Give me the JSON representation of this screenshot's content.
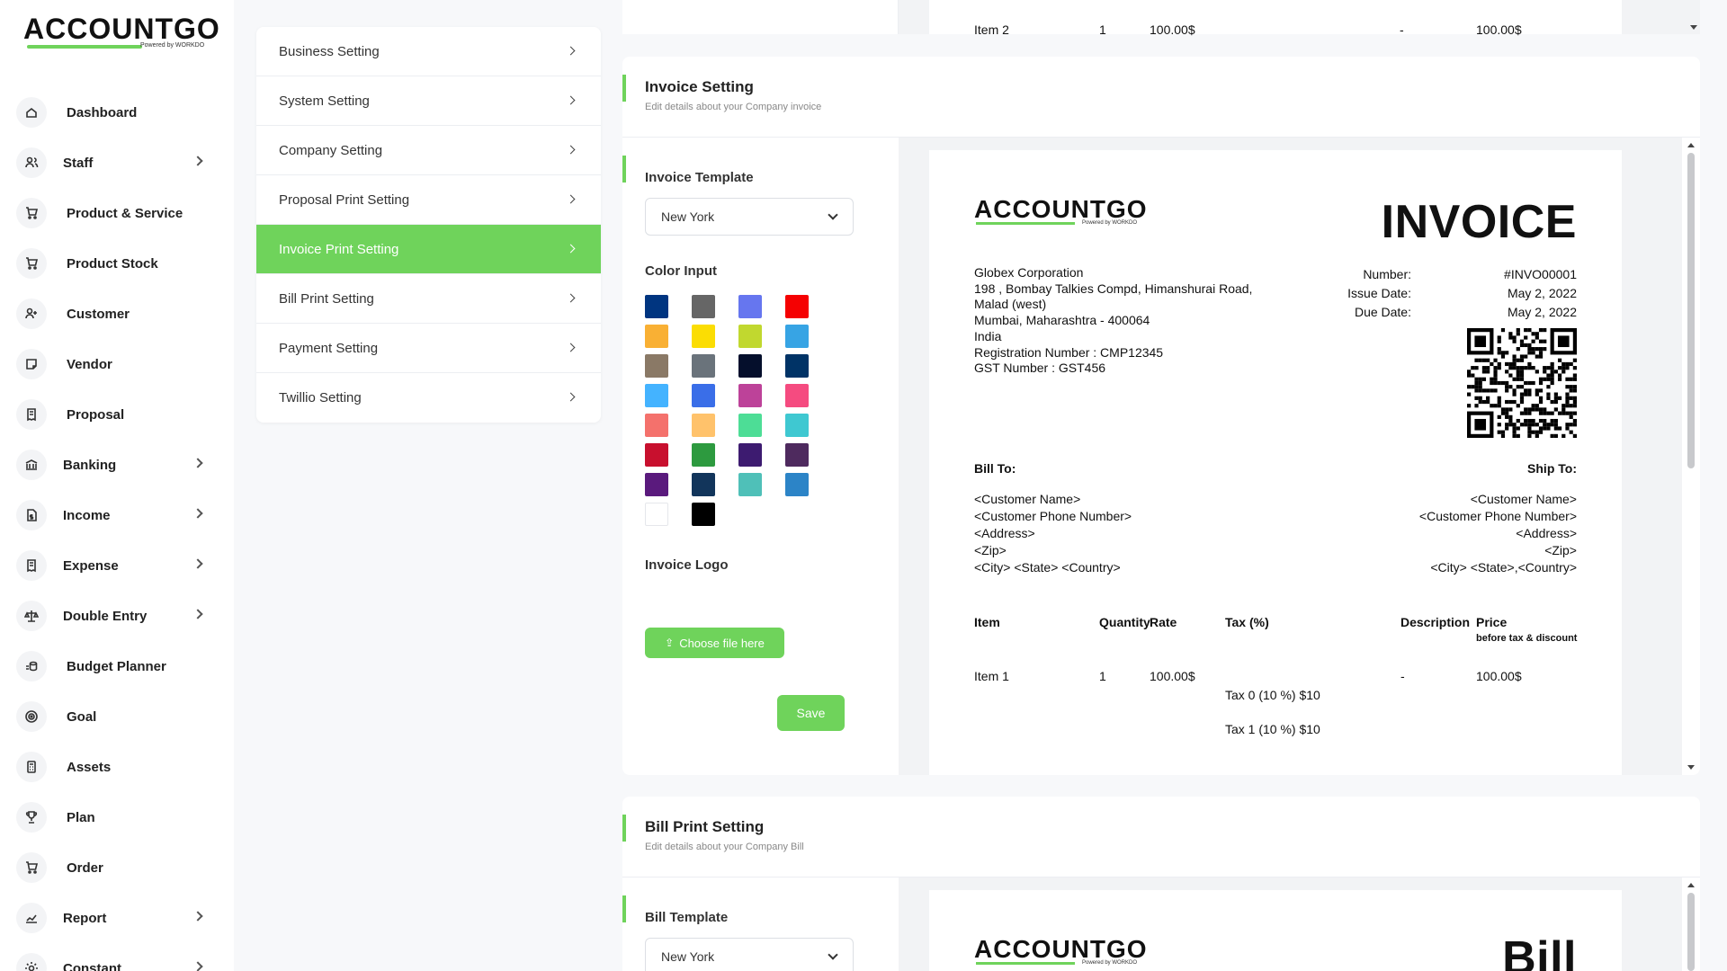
{
  "brand": {
    "name": "ACCOUNTGO",
    "powered": "Powered by WORKDO"
  },
  "sidebar": {
    "items": [
      {
        "label": "Dashboard",
        "icon": "home-icon",
        "sub": false
      },
      {
        "label": "Staff",
        "icon": "users-icon",
        "sub": true
      },
      {
        "label": "Product & Service",
        "icon": "cart-icon",
        "sub": false
      },
      {
        "label": "Product Stock",
        "icon": "cart-icon",
        "sub": false
      },
      {
        "label": "Customer",
        "icon": "user-plus-icon",
        "sub": false
      },
      {
        "label": "Vendor",
        "icon": "note-icon",
        "sub": false
      },
      {
        "label": "Proposal",
        "icon": "receipt-icon",
        "sub": false
      },
      {
        "label": "Banking",
        "icon": "bank-icon",
        "sub": true
      },
      {
        "label": "Income",
        "icon": "file-dollar-icon",
        "sub": true
      },
      {
        "label": "Expense",
        "icon": "receipt-icon",
        "sub": true
      },
      {
        "label": "Double Entry",
        "icon": "scale-icon",
        "sub": true
      },
      {
        "label": "Budget Planner",
        "icon": "coins-icon",
        "sub": false
      },
      {
        "label": "Goal",
        "icon": "target-icon",
        "sub": false
      },
      {
        "label": "Assets",
        "icon": "calculator-icon",
        "sub": false
      },
      {
        "label": "Plan",
        "icon": "trophy-icon",
        "sub": false
      },
      {
        "label": "Order",
        "icon": "cart-icon",
        "sub": false
      },
      {
        "label": "Report",
        "icon": "chart-icon",
        "sub": true
      },
      {
        "label": "Constant",
        "icon": "gear-icon",
        "sub": true
      }
    ]
  },
  "settings_menu": [
    {
      "label": "Business Setting",
      "active": false
    },
    {
      "label": "System Setting",
      "active": false
    },
    {
      "label": "Company Setting",
      "active": false
    },
    {
      "label": "Proposal Print Setting",
      "active": false
    },
    {
      "label": "Invoice Print Setting",
      "active": true
    },
    {
      "label": "Bill Print Setting",
      "active": false
    },
    {
      "label": "Payment Setting",
      "active": false
    },
    {
      "label": "Twillio Setting",
      "active": false
    }
  ],
  "top_strip": {
    "item": "Item 2",
    "qty": "1",
    "rate": "100.00$",
    "desc": "-",
    "price": "100.00$"
  },
  "invoice_setting": {
    "title": "Invoice Setting",
    "subtitle": "Edit details about your Company invoice",
    "template_label": "Invoice Template",
    "template_value": "New York",
    "color_label": "Color Input",
    "logo_label": "Invoice Logo",
    "choose_file": "Choose file here",
    "save": "Save",
    "colors": [
      "#003580",
      "#666666",
      "#6676ef",
      "#f50102",
      "#f9b034",
      "#fbdd03",
      "#c1d82f",
      "#37a4e4",
      "#8a7966",
      "#6a737b",
      "#050f2c",
      "#003366",
      "#44b3ff",
      "#3a6ee8",
      "#bd4299",
      "#f54b80",
      "#f4716c",
      "#ffc26b",
      "#4ddd96",
      "#3fc8d1",
      "#c8102e",
      "#2d9a3f",
      "#3d1b70",
      "#4e2a5e",
      "#5a1a7d",
      "#12355b",
      "#4fc0b8",
      "#2c84c7",
      "#ffffff",
      "#000000"
    ]
  },
  "invoice_preview": {
    "heading": "INVOICE",
    "company": [
      "Globex Corporation",
      "198 , Bombay Talkies Compd, Himanshurai Road,",
      "Malad (west)",
      "Mumbai, Maharashtra - 400064",
      "India",
      "Registration Number : CMP12345",
      "GST Number : GST456"
    ],
    "meta_labels": [
      "Number:",
      "Issue Date:",
      "Due Date:"
    ],
    "meta_values": [
      "#INVO00001",
      "May 2, 2022",
      "May 2, 2022"
    ],
    "bill_to": "Bill To:",
    "ship_to": "Ship To:",
    "bill_lines": [
      "<Customer Name>",
      "<Customer Phone Number>",
      "<Address>",
      "<Zip>",
      "<City> <State> <Country>"
    ],
    "ship_lines": [
      "<Customer Name>",
      "<Customer Phone Number>",
      "<Address>",
      "<Zip>",
      "<City> <State>,<Country>"
    ],
    "col_item": "Item",
    "col_qty": "Quantity",
    "col_rate": "Rate",
    "col_tax": "Tax (%)",
    "col_desc": "Description",
    "col_price": "Price",
    "col_price_sub": "before tax & discount",
    "row_item": "Item 1",
    "row_qty": "1",
    "row_rate": "100.00$",
    "row_desc": "-",
    "row_price": "100.00$",
    "tax0": "Tax 0  (10 %) $10",
    "tax1": "Tax 1  (10 %) $10"
  },
  "bill_setting": {
    "title": "Bill Print Setting",
    "subtitle": "Edit details about your Company Bill",
    "template_label": "Bill Template",
    "template_value": "New York",
    "heading": "Bill"
  }
}
